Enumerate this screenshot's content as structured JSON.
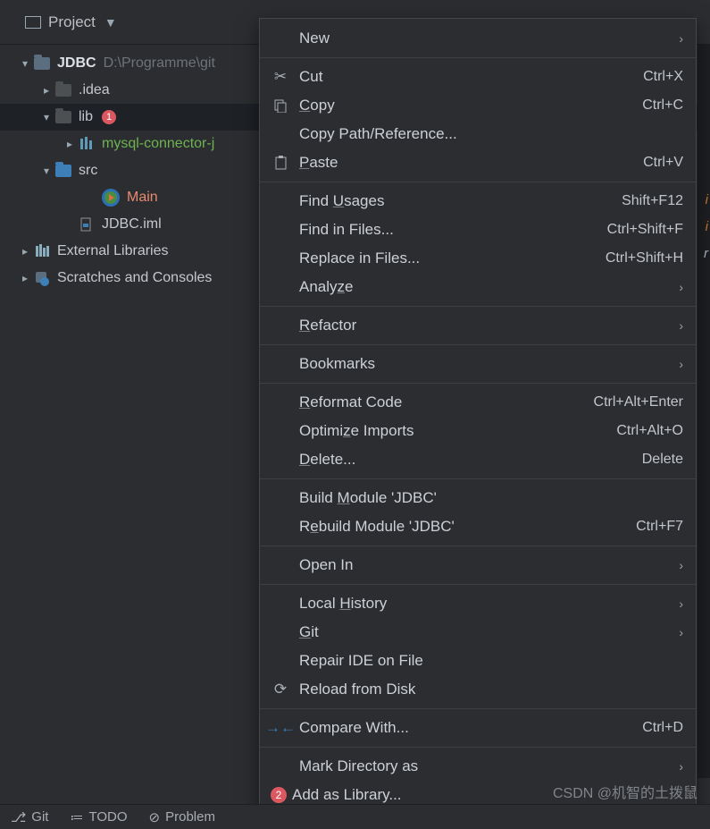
{
  "panel": {
    "title": "Project"
  },
  "tree": {
    "root": {
      "name": "JDBC",
      "path": "D:\\Programme\\git"
    },
    "idea": ".idea",
    "lib": {
      "name": "lib",
      "badge": "1"
    },
    "mysql": "mysql-connector-j",
    "src": "src",
    "main": "Main",
    "iml": "JDBC.iml",
    "ext": "External Libraries",
    "scratch": "Scratches and Consoles"
  },
  "menu": {
    "new": "New",
    "cut": {
      "label": "Cut",
      "sc": "Ctrl+X"
    },
    "copy": {
      "label": "Copy",
      "sc": "Ctrl+C"
    },
    "copyPath": "Copy Path/Reference...",
    "paste": {
      "label": "Paste",
      "sc": "Ctrl+V"
    },
    "findUsages": {
      "label": "Find Usages",
      "sc": "Shift+F12"
    },
    "findFiles": {
      "label": "Find in Files...",
      "sc": "Ctrl+Shift+F"
    },
    "replaceFiles": {
      "label": "Replace in Files...",
      "sc": "Ctrl+Shift+H"
    },
    "analyze": "Analyze",
    "refactor": "Refactor",
    "bookmarks": "Bookmarks",
    "reformat": {
      "label": "Reformat Code",
      "sc": "Ctrl+Alt+Enter"
    },
    "optimize": {
      "label": "Optimize Imports",
      "sc": "Ctrl+Alt+O"
    },
    "delete": {
      "label": "Delete...",
      "sc": "Delete"
    },
    "build": "Build Module 'JDBC'",
    "rebuild": {
      "label": "Rebuild Module 'JDBC'",
      "sc": "Ctrl+F7"
    },
    "openIn": "Open In",
    "localHistory": "Local History",
    "git": "Git",
    "repair": "Repair IDE on File",
    "reload": "Reload from Disk",
    "compare": {
      "label": "Compare With...",
      "sc": "Ctrl+D"
    },
    "markDir": "Mark Directory as",
    "addLib": {
      "label": "Add as Library...",
      "badge": "2"
    }
  },
  "bottom": {
    "git": "Git",
    "todo": "TODO",
    "problems": "Problem"
  },
  "watermark": "CSDN @机智的土拨鼠",
  "editorPeek": [
    "i",
    "i",
    "r"
  ]
}
